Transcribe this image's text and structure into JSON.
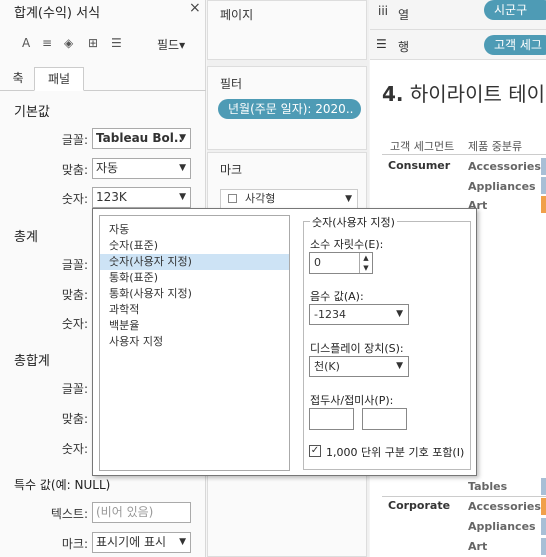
{
  "format_pane": {
    "title": "합계(수익) 서식",
    "close": "×",
    "toolbar": {
      "font_icon": "A",
      "align_icon": "≡",
      "fill_icon": "◈",
      "border_icon": "⊞",
      "lines_icon": "☰",
      "fields_label": "필드",
      "fields_caret": "▾"
    },
    "tabs": [
      "축",
      "패널"
    ],
    "sections": {
      "default": "기본값",
      "totals": "총계",
      "grand_totals": "총합계",
      "special": "특수 값(예: NULL)"
    },
    "labels": {
      "font": "글꼴:",
      "align": "맞춤:",
      "numbers": "숫자:",
      "text": "텍스트:",
      "marks": "마크:"
    },
    "default_font": "Tableau Bol..",
    "default_align": "자동",
    "default_numbers": "123K",
    "special_text_placeholder": "(비어 있음)",
    "special_marks": "표시기에 표시"
  },
  "middle": {
    "pages": "페이지",
    "filters": "필터",
    "filter_pill": "년월(주문 일자): 2020..",
    "marks": "마크",
    "mark_type": "사각형"
  },
  "right": {
    "cols_icon": "iii",
    "cols_label": "열",
    "cols_pill": "시군구",
    "rows_icon": "☰",
    "rows_label": "행",
    "rows_pill": "고객 세그",
    "viz_title_num": "4.",
    "viz_title": "하이라이트 테이",
    "header_segment": "고객 세그먼트",
    "header_subcat": "제품 중분류",
    "consumer": "Consumer",
    "corporate": "Corporate",
    "rows_top": [
      "Accessories",
      "Appliances",
      "Art"
    ],
    "rows_bottom": [
      "Tables",
      "Accessories",
      "Appliances",
      "Art"
    ]
  },
  "popup": {
    "list": [
      "자동",
      "숫자(표준)",
      "숫자(사용자 지정)",
      "통화(표준)",
      "통화(사용자 지정)",
      "과학적",
      "백분율",
      "사용자 지정"
    ],
    "selected_index": 2,
    "group_title": "숫자(사용자 지정)",
    "decimals_label": "소수 자릿수(E):",
    "decimals_value": "0",
    "negative_label": "음수 값(A):",
    "negative_value": "-1234",
    "display_label": "디스플레이 장치(S):",
    "display_value": "천(K)",
    "prefix_label": "접두사/접미사(P):",
    "thousands_label": "1,000 단위 구분 기호 포함(I)",
    "thousands_checked": true
  },
  "colors": {
    "pill": "#4e9bb5",
    "selection": "#cde3f5",
    "bar_orange": "#f0a04b",
    "bar_blue": "#a8bfd6"
  }
}
